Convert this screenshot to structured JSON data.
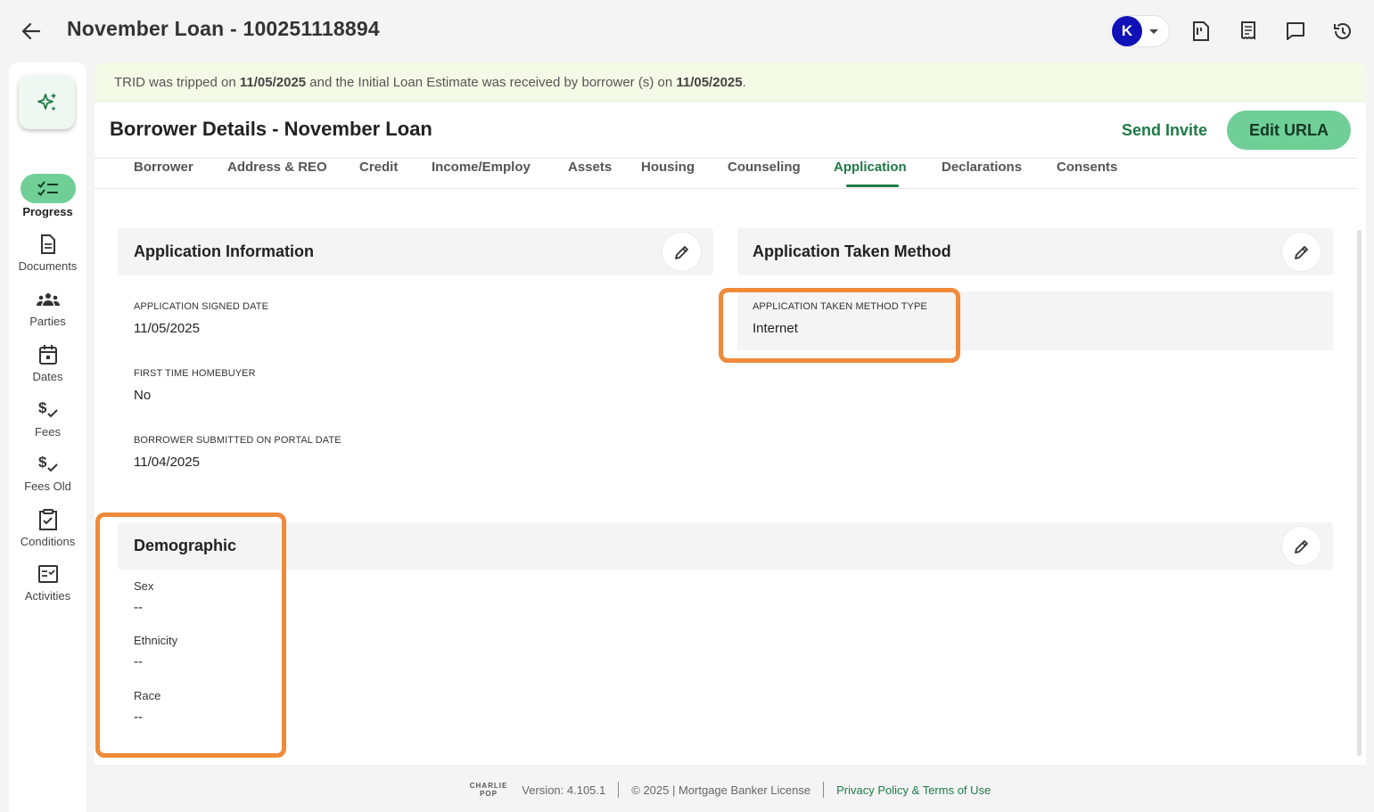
{
  "header": {
    "loan_title": "November Loan - 100251118894",
    "avatar_initial": "K",
    "icons": [
      "document-icon",
      "receipt-icon",
      "chat-icon",
      "history-icon"
    ]
  },
  "nav": {
    "items": [
      {
        "label": "Progress",
        "icon": "checklist-icon",
        "active": true
      },
      {
        "label": "Documents",
        "icon": "document-icon"
      },
      {
        "label": "Parties",
        "icon": "people-icon"
      },
      {
        "label": "Dates",
        "icon": "calendar-icon"
      },
      {
        "label": "Fees",
        "icon": "dollar-check-icon"
      },
      {
        "label": "Fees Old",
        "icon": "dollar-check-icon"
      },
      {
        "label": "Conditions",
        "icon": "clipboard-check-icon"
      },
      {
        "label": "Activities",
        "icon": "checkbox-list-icon"
      }
    ]
  },
  "banner": {
    "prefix": "TRID was tripped on ",
    "date1": "11/05/2025",
    "middle": " and the Initial Loan Estimate was received by borrower (s) on ",
    "date2": "11/05/2025",
    "suffix": "."
  },
  "page": {
    "title": "Borrower Details - November Loan",
    "send_invite": "Send Invite",
    "edit_urla": "Edit URLA"
  },
  "tabs": [
    "Borrower",
    "Address & REO",
    "Credit",
    "Income/Employ",
    "Assets",
    "Housing",
    "Counseling",
    "Application",
    "Declarations",
    "Consents"
  ],
  "active_tab": "Application",
  "application_info": {
    "title": "Application Information",
    "fields": [
      {
        "label": "APPLICATION SIGNED DATE",
        "value": "11/05/2025"
      },
      {
        "label": "FIRST TIME HOMEBUYER",
        "value": "No"
      },
      {
        "label": "BORROWER SUBMITTED ON PORTAL DATE",
        "value": "11/04/2025"
      }
    ]
  },
  "taken_method": {
    "title": "Application Taken Method",
    "label": "APPLICATION TAKEN METHOD TYPE",
    "value": "Internet"
  },
  "demographic": {
    "title": "Demographic",
    "fields": [
      {
        "label": "Sex",
        "value": "--"
      },
      {
        "label": "Ethnicity",
        "value": "--"
      },
      {
        "label": "Race",
        "value": "--"
      }
    ]
  },
  "footer": {
    "logo_top": "CHARLIE",
    "logo_bottom": "POP",
    "version": "Version: 4.105.1",
    "copyright": "© 2025 | Mortgage Banker License",
    "privacy": "Privacy Policy & Terms of Use"
  },
  "colors": {
    "accent": "#1e7a46",
    "button": "#6fcf97",
    "highlight": "#ef8a3a",
    "avatar": "#1111b8"
  }
}
